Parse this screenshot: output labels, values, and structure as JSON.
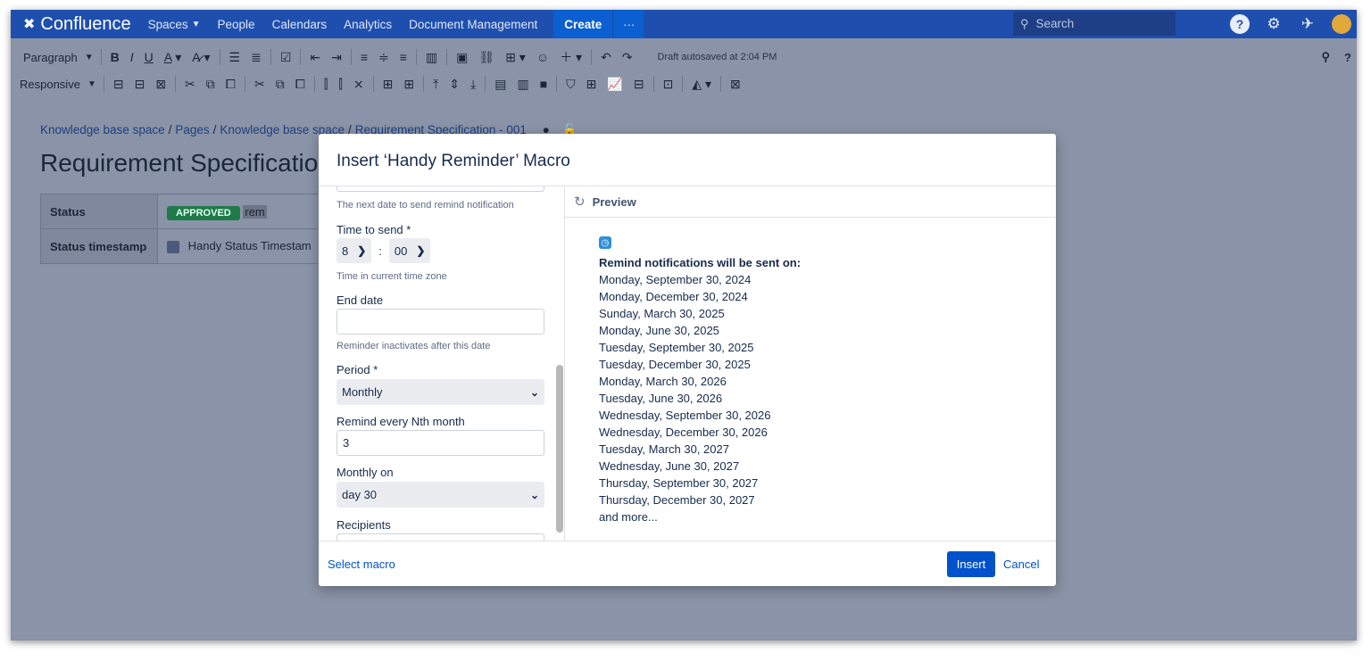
{
  "topnav": {
    "logo": "Confluence",
    "items": [
      {
        "label": "Spaces",
        "dropdown": true
      },
      {
        "label": "People",
        "dropdown": false
      },
      {
        "label": "Calendars",
        "dropdown": false
      },
      {
        "label": "Analytics",
        "dropdown": false
      },
      {
        "label": "Document Management",
        "dropdown": false
      }
    ],
    "create_label": "Create",
    "more_label": "···",
    "search_placeholder": "Search",
    "icons": [
      "help-icon",
      "gear-icon",
      "notifications-icon",
      "avatar"
    ]
  },
  "toolbar": {
    "paragraph_label": "Paragraph",
    "responsive_label": "Responsive",
    "autosave_text": "Draft autosaved at 2:04 PM"
  },
  "page": {
    "breadcrumb": [
      "Knowledge base space",
      "Pages",
      "Knowledge base space",
      "Requirement Specification - 001"
    ],
    "title": "Requirement Specification",
    "table": {
      "status_label": "Status",
      "status_badge": "APPROVED",
      "status_extra": "rem",
      "timestamp_label": "Status timestamp",
      "timestamp_value": "Handy Status Timestam"
    }
  },
  "modal": {
    "title": "Insert ‘Handy Reminder’ Macro",
    "form": {
      "next_date_hint": "The next date to send remind notification",
      "time_label": "Time to send *",
      "time_hour": "8",
      "time_minute": "00",
      "time_hint": "Time in current time zone",
      "end_date_label": "End date",
      "end_date_value": "",
      "end_date_hint": "Reminder inactivates after this date",
      "period_label": "Period *",
      "period_value": "Monthly",
      "nth_label": "Remind every Nth month",
      "nth_value": "3",
      "monthly_on_label": "Monthly on",
      "monthly_on_value": "day 30",
      "recipients_label": "Recipients"
    },
    "preview": {
      "label": "Preview",
      "heading": "Remind notifications will be sent on:",
      "dates": [
        "Monday, September 30, 2024",
        "Monday, December 30, 2024",
        "Sunday, March 30, 2025",
        "Monday, June 30, 2025",
        "Tuesday, September 30, 2025",
        "Tuesday, December 30, 2025",
        "Monday, March 30, 2026",
        "Tuesday, June 30, 2026",
        "Wednesday, September 30, 2026",
        "Wednesday, December 30, 2026",
        "Tuesday, March 30, 2027",
        "Wednesday, June 30, 2027",
        "Thursday, September 30, 2027",
        "Thursday, December 30, 2027"
      ],
      "more": "and more..."
    },
    "footer": {
      "select_macro": "Select macro",
      "insert": "Insert",
      "cancel": "Cancel"
    }
  },
  "colors": {
    "nav_bg": "#1f4fae",
    "primary": "#0052cc",
    "approved_badge": "#1f7a4a",
    "overlay": "#8a93a7"
  }
}
